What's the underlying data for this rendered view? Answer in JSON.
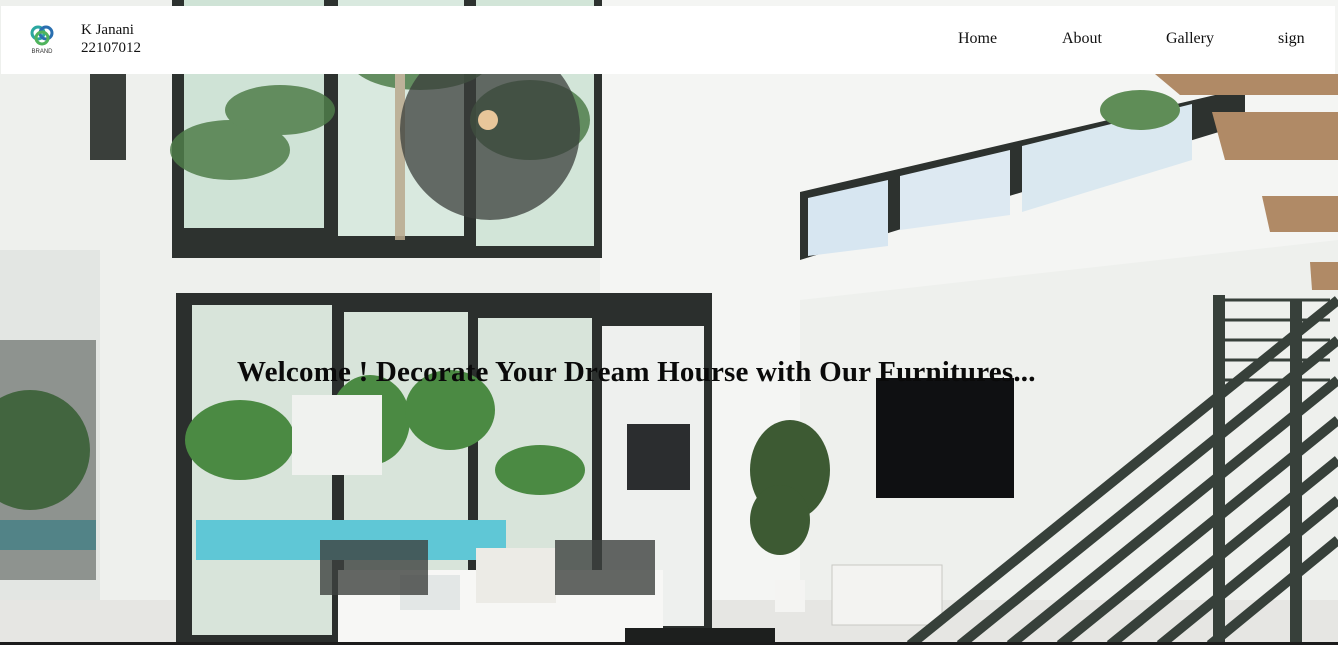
{
  "header": {
    "logo_text": "BRAND",
    "user_name": "K Janani",
    "user_id": "22107012"
  },
  "nav": {
    "home": "Home",
    "about": "About",
    "gallery": "Gallery",
    "sign": "sign"
  },
  "hero": {
    "headline": "Welcome ! Decorate Your Dream Hourse with Our Furnitures..."
  },
  "colors": {
    "header_bg": "#ffffff",
    "text": "#111111",
    "window_frame": "#2b2f2d"
  }
}
